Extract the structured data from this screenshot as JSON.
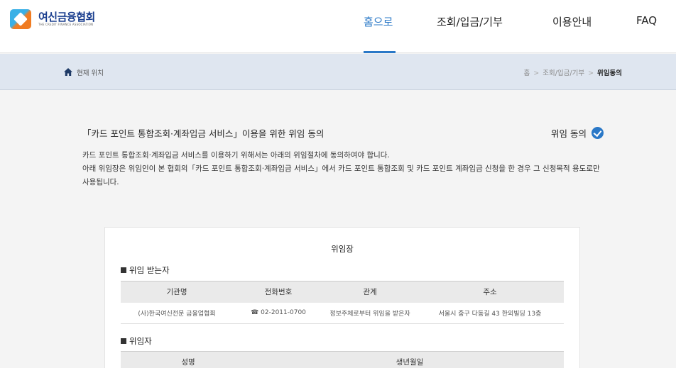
{
  "header": {
    "logo": {
      "name_kr": "여신금융협회",
      "name_en": "THE CREDIT FINANCE ASSOCIATION"
    },
    "nav": [
      {
        "label": "홈으로",
        "active": true
      },
      {
        "label": "조회/입금/기부",
        "active": false
      },
      {
        "label": "이용안내",
        "active": false
      },
      {
        "label": "FAQ",
        "active": false
      }
    ]
  },
  "location": {
    "label": "현재 위치",
    "breadcrumb": [
      "홈",
      "조회/입금/기부",
      "위임동의"
    ]
  },
  "intro": {
    "title": "「카드 포인트 통합조회·계좌입금 서비스」이용을 위한 위임 동의",
    "consent_label": "위임 동의",
    "desc_line1": "카드 포인트 통합조회·계좌입금 서비스를 이용하기 위해서는 아래의 위임절차에 동의하여야 합니다.",
    "desc_line2": "아래 위임장은 위임인이 본 협회의「카드 포인트 통합조회·계좌입금 서비스」에서 카드 포인트 통합조회 및 카드 포인트 계좌입금 신청을 한 경우 그 신청목적 용도로만 사용됩니다."
  },
  "document": {
    "title": "위임장",
    "delegatee": {
      "heading": "위임 받는자",
      "columns": [
        "기관명",
        "전화번호",
        "관계",
        "주소"
      ],
      "row": [
        "(사)한국여신전문 금융업협회",
        "☎ 02-2011-0700",
        "정보주체로부터 위임을 받은자",
        "서울시 중구 다동길 43 한외빌딩 13층"
      ]
    },
    "delegator": {
      "heading": "위임자",
      "columns": [
        "성명",
        "생년월일"
      ]
    }
  },
  "colors": {
    "accent": "#2a78c7",
    "brand": "#1b3f8f",
    "locbar": "#dfe6f0"
  }
}
